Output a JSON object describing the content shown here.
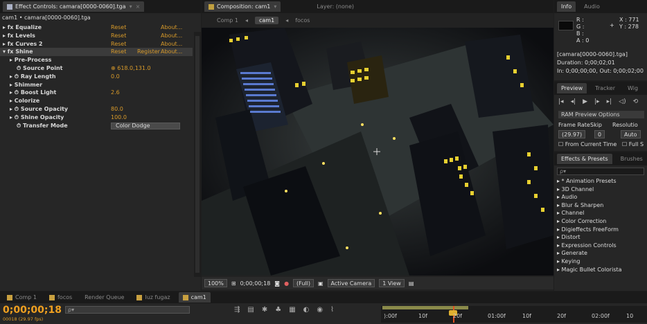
{
  "effect_controls": {
    "tab_label": "Effect Controls: camara[0000-0060].tga",
    "header": "cam1 • camara[0000-0060].tga",
    "rows": [
      {
        "indent": 0,
        "label": "▸ fx Equalize",
        "v1": "Reset",
        "v3": "About..."
      },
      {
        "indent": 0,
        "label": "▸ fx Levels",
        "v1": "Reset",
        "v3": "About..."
      },
      {
        "indent": 0,
        "label": "▸ fx Curves 2",
        "v1": "Reset",
        "v3": "About..."
      },
      {
        "indent": 0,
        "label": "▾ fx Shine",
        "v1": "Reset",
        "v2": "Register",
        "v3": "About...",
        "selected": true
      },
      {
        "indent": 1,
        "label": "▸ Pre-Process"
      },
      {
        "indent": 2,
        "label": "⏱ Source Point",
        "v1": "⊕  618.0,131.0"
      },
      {
        "indent": 1,
        "label": "▸ ⏱ Ray Length",
        "v1": "0.0"
      },
      {
        "indent": 1,
        "label": "▸ Shimmer"
      },
      {
        "indent": 1,
        "label": "▸ ⏱ Boost Light",
        "v1": "2.6"
      },
      {
        "indent": 1,
        "label": "▸ Colorize"
      },
      {
        "indent": 1,
        "label": "▸ ⏱ Source Opacity",
        "v1": "80.0"
      },
      {
        "indent": 1,
        "label": "▸ ⏱ Shine Opacity",
        "v1": "100.0"
      },
      {
        "indent": 2,
        "label": "⏱ Transfer Mode",
        "dropdown": "Color Dodge"
      }
    ]
  },
  "composition": {
    "tab_label": "Composition: cam1",
    "layer_label": "Layer: (none)",
    "breadcrumb": [
      "Comp 1",
      "cam1",
      "focos"
    ],
    "bottom": {
      "zoom": "100%",
      "timecode": "0;00;00;18",
      "resolution": "(Full)",
      "camera": "Active Camera",
      "views": "1 View"
    }
  },
  "info": {
    "tabs": [
      "Info",
      "Audio"
    ],
    "r": "R :",
    "g": "G :",
    "b": "B :",
    "a": "A : 0",
    "x": "X : 771",
    "y": "Y : 278",
    "file": "[camara[0000-0060].tga]",
    "duration": "Duration: 0;00;02;01",
    "inout": "In: 0;00;00;00, Out: 0;00;02;00"
  },
  "preview": {
    "tabs": [
      "Preview",
      "Tracker",
      "Wig"
    ],
    "ram_options": "RAM Preview Options",
    "frame_rate_label": "Frame Rate",
    "skip_label": "Skip",
    "resolution_label": "Resolutio",
    "frame_rate": "(29.97)",
    "skip": "0",
    "resolution": "Auto",
    "from_current": "From Current Time",
    "full_screen": "Full S"
  },
  "effects_presets": {
    "tabs": [
      "Effects & Presets",
      "Brushes"
    ],
    "search_placeholder": "ρ▾",
    "items": [
      "▸ * Animation Presets",
      "▸ 3D Channel",
      "▸ Audio",
      "▸ Blur & Sharpen",
      "▸ Channel",
      "▸ Color Correction",
      "▸ Digieffects FreeForm",
      "▸ Distort",
      "▸ Expression Controls",
      "▸ Generate",
      "▸ Keying",
      "▸ Magic Bullet Colorista"
    ]
  },
  "timeline": {
    "tabs": [
      "Comp 1",
      "focos",
      "Render Queue",
      "luz fugaz",
      "cam1"
    ],
    "timecode": "0;00;00;18",
    "fps_line": "00018 (29.97 fps)",
    "search_placeholder": "ρ▾",
    "ruler": [
      "):00f",
      "10f",
      "20f",
      "01:00f",
      "10f",
      "20f",
      "02:00f",
      "10"
    ]
  }
}
